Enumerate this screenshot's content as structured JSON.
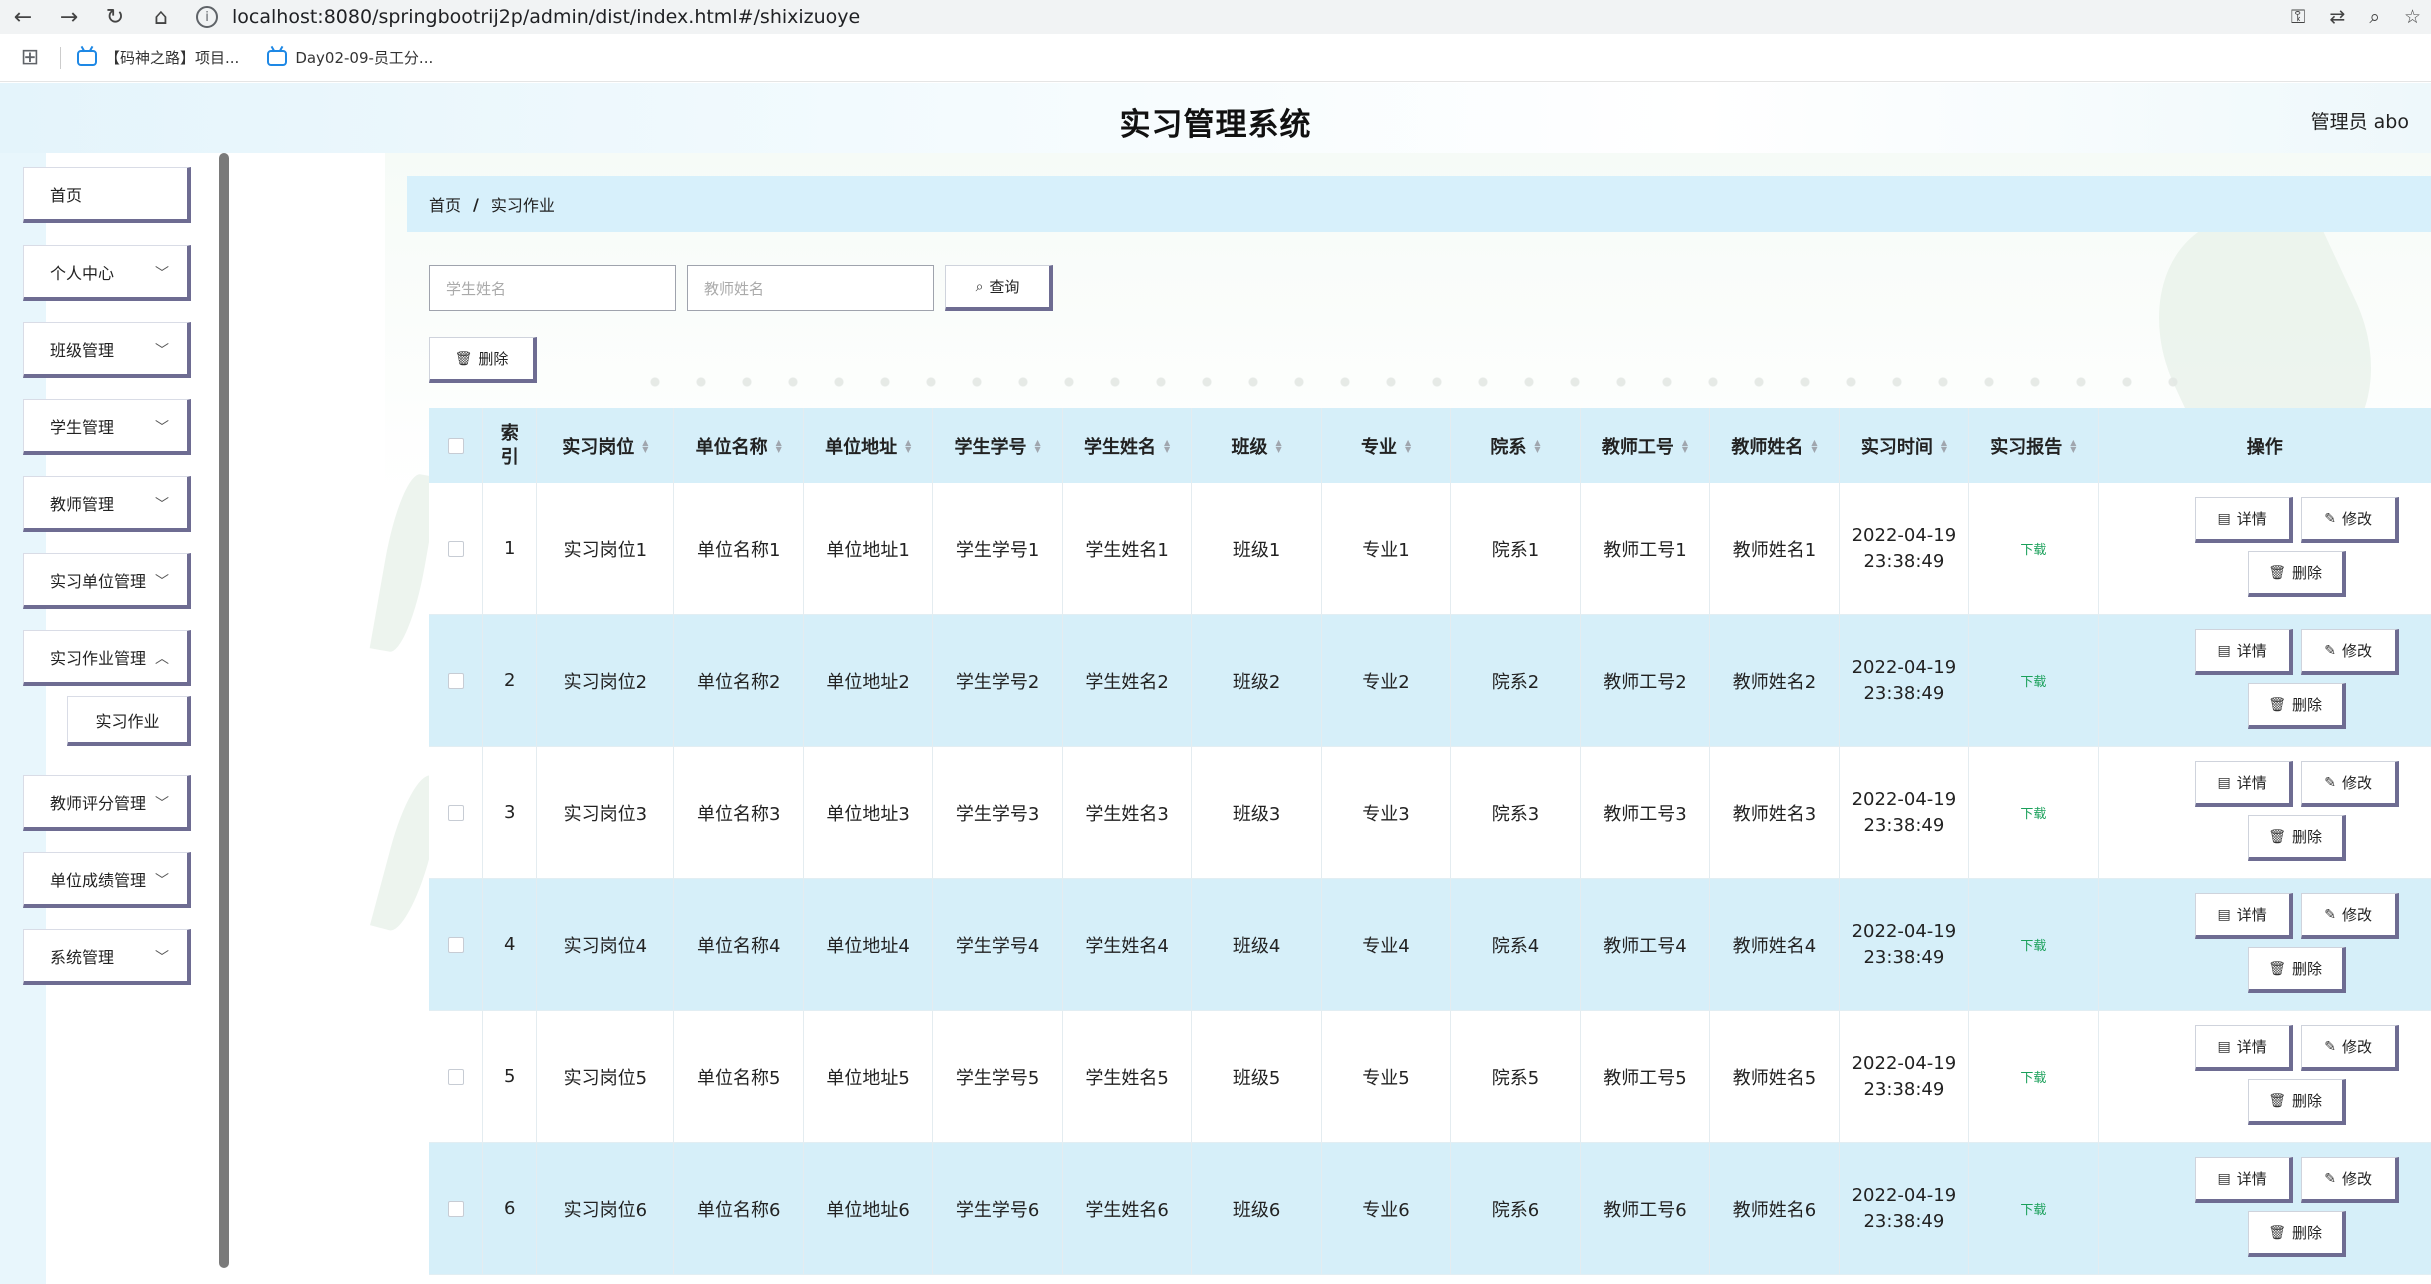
{
  "browser": {
    "back": "←",
    "forward": "→",
    "reload": "↻",
    "home": "⌂",
    "url": "localhost:8080/springbootrij2p/admin/dist/index.html#/shixizuoye",
    "bookmarks": [
      {
        "label": "【码神之路】项目..."
      },
      {
        "label": "Day02-09-员工分..."
      }
    ]
  },
  "header": {
    "title": "实习管理系统",
    "user": "管理员 abo"
  },
  "sidebar": {
    "items": [
      {
        "label": "首页",
        "has_children": false
      },
      {
        "label": "个人中心",
        "has_children": true
      },
      {
        "label": "班级管理",
        "has_children": true
      },
      {
        "label": "学生管理",
        "has_children": true
      },
      {
        "label": "教师管理",
        "has_children": true
      },
      {
        "label": "实习单位管理",
        "has_children": true
      },
      {
        "label": "实习作业管理",
        "has_children": true
      },
      {
        "label": "教师评分管理",
        "has_children": true
      },
      {
        "label": "单位成绩管理",
        "has_children": true
      },
      {
        "label": "系统管理",
        "has_children": true
      }
    ],
    "submenu": {
      "label": "实习作业"
    }
  },
  "breadcrumb": {
    "home": "首页",
    "separator": "/",
    "current": "实习作业"
  },
  "search": {
    "student_placeholder": "学生姓名",
    "teacher_placeholder": "教师姓名",
    "query_label": "查询"
  },
  "toolbar": {
    "delete_label": "删除"
  },
  "table": {
    "headers": {
      "index": "索引",
      "position": "实习岗位",
      "unit_name": "单位名称",
      "unit_address": "单位地址",
      "student_no": "学生学号",
      "student_name": "学生姓名",
      "class": "班级",
      "major": "专业",
      "department": "院系",
      "teacher_no": "教师工号",
      "teacher_name": "教师姓名",
      "time": "实习时间",
      "report": "实习报告",
      "actions": "操作"
    },
    "rows": [
      {
        "index": "1",
        "position": "实习岗位1",
        "unit_name": "单位名称1",
        "unit_address": "单位地址1",
        "student_no": "学生学号1",
        "student_name": "学生姓名1",
        "class": "班级1",
        "major": "专业1",
        "department": "院系1",
        "teacher_no": "教师工号1",
        "teacher_name": "教师姓名1",
        "date": "2022-04-19",
        "clock": "23:38:49",
        "report": "下载"
      },
      {
        "index": "2",
        "position": "实习岗位2",
        "unit_name": "单位名称2",
        "unit_address": "单位地址2",
        "student_no": "学生学号2",
        "student_name": "学生姓名2",
        "class": "班级2",
        "major": "专业2",
        "department": "院系2",
        "teacher_no": "教师工号2",
        "teacher_name": "教师姓名2",
        "date": "2022-04-19",
        "clock": "23:38:49",
        "report": "下载"
      },
      {
        "index": "3",
        "position": "实习岗位3",
        "unit_name": "单位名称3",
        "unit_address": "单位地址3",
        "student_no": "学生学号3",
        "student_name": "学生姓名3",
        "class": "班级3",
        "major": "专业3",
        "department": "院系3",
        "teacher_no": "教师工号3",
        "teacher_name": "教师姓名3",
        "date": "2022-04-19",
        "clock": "23:38:49",
        "report": "下载"
      },
      {
        "index": "4",
        "position": "实习岗位4",
        "unit_name": "单位名称4",
        "unit_address": "单位地址4",
        "student_no": "学生学号4",
        "student_name": "学生姓名4",
        "class": "班级4",
        "major": "专业4",
        "department": "院系4",
        "teacher_no": "教师工号4",
        "teacher_name": "教师姓名4",
        "date": "2022-04-19",
        "clock": "23:38:49",
        "report": "下载"
      },
      {
        "index": "5",
        "position": "实习岗位5",
        "unit_name": "单位名称5",
        "unit_address": "单位地址5",
        "student_no": "学生学号5",
        "student_name": "学生姓名5",
        "class": "班级5",
        "major": "专业5",
        "department": "院系5",
        "teacher_no": "教师工号5",
        "teacher_name": "教师姓名5",
        "date": "2022-04-19",
        "clock": "23:38:49",
        "report": "下载"
      },
      {
        "index": "6",
        "position": "实习岗位6",
        "unit_name": "单位名称6",
        "unit_address": "单位地址6",
        "student_no": "学生学号6",
        "student_name": "学生姓名6",
        "class": "班级6",
        "major": "专业6",
        "department": "院系6",
        "teacher_no": "教师工号6",
        "teacher_name": "教师姓名6",
        "date": "2022-04-19",
        "clock": "23:38:49",
        "report": "下载"
      }
    ],
    "row_actions": {
      "detail": "详情",
      "edit": "修改",
      "delete": "删除"
    }
  },
  "colors": {
    "header_bg": "#e4f4fb",
    "table_header_bg": "#d6eff9",
    "button_shadow": "#6e6c92",
    "download_link": "#1aa05a"
  }
}
